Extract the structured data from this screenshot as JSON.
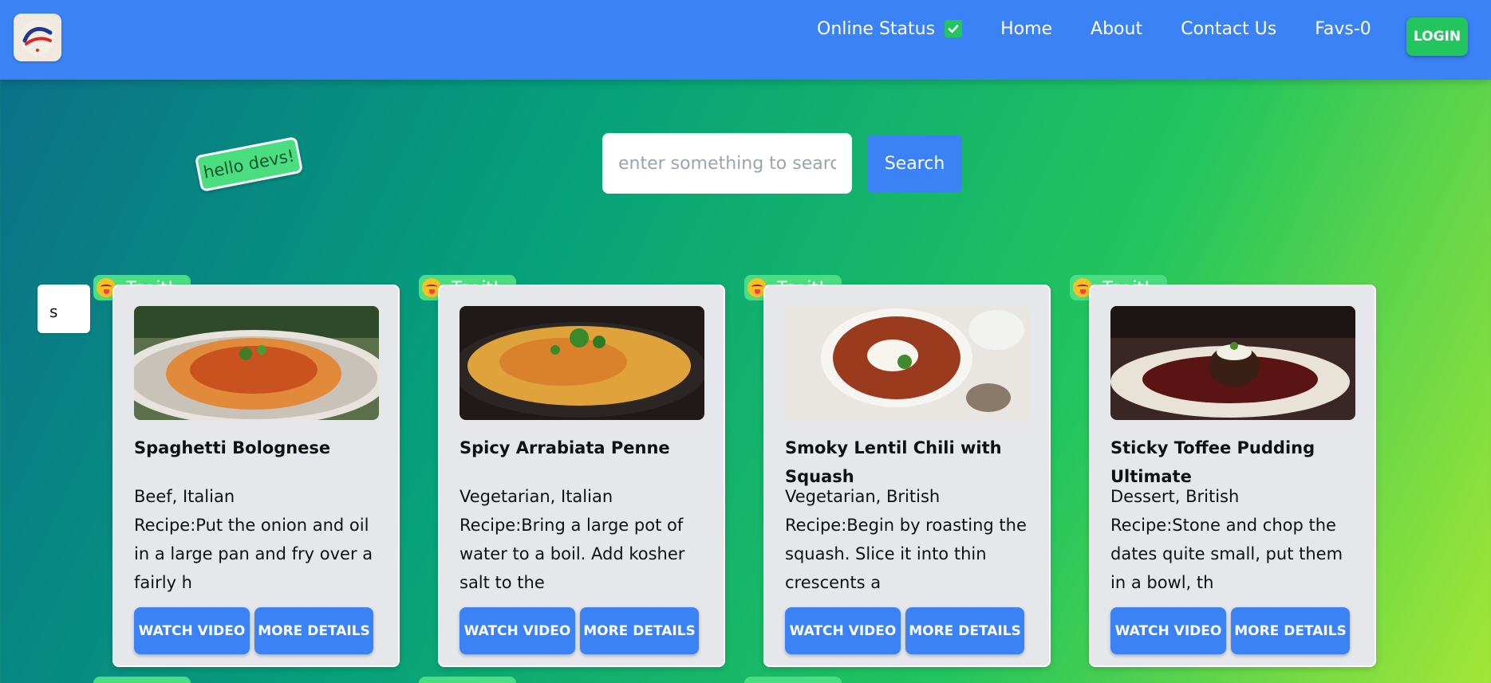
{
  "nav": {
    "online_status": "Online Status",
    "home": "Home",
    "about": "About",
    "contact": "Contact Us",
    "favs": "Favs-0",
    "login": "LOGIN"
  },
  "sticker_text": "hello devs!",
  "search": {
    "placeholder": "enter something to search",
    "button": "Search"
  },
  "side_input_value": "s",
  "colors": {
    "nav_blue": "#3b82f6",
    "accent_green": "#22c55e",
    "tag_green": "#4ade80",
    "card_bg": "#e5e7eb"
  },
  "cards": [
    {
      "tag": "Try it!",
      "title": "Spaghetti Bolognese",
      "meta": "Beef, Italian",
      "recipe": "Recipe:Put the onion and oil in a large pan and fry over a fairly h",
      "watch": "WATCH VIDEO",
      "more": "MORE DETAILS"
    },
    {
      "tag": "Try it!",
      "title": "Spicy Arrabiata Penne",
      "meta": "Vegetarian, Italian",
      "recipe": "Recipe:Bring a large pot of water to a boil. Add kosher salt to the",
      "watch": "WATCH VIDEO",
      "more": "MORE DETAILS"
    },
    {
      "tag": "Try it!",
      "title": "Smoky Lentil Chili with Squash",
      "meta": "Vegetarian, British",
      "recipe": "Recipe:Begin by roasting the squash. Slice it into thin crescents a",
      "watch": "WATCH VIDEO",
      "more": "MORE DETAILS"
    },
    {
      "tag": "Try it!",
      "title": "Sticky Toffee Pudding Ultimate",
      "meta": "Dessert, British",
      "recipe": "Recipe:Stone and chop the dates quite small, put them in a bowl, th",
      "watch": "WATCH VIDEO",
      "more": "MORE DETAILS"
    }
  ]
}
